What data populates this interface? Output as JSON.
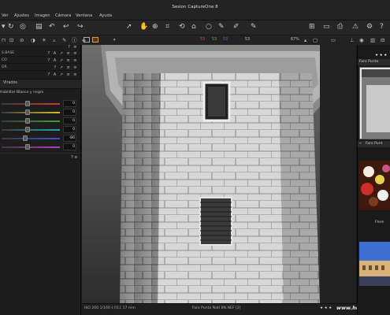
{
  "window": {
    "title": "Sesion CaptureOne 8"
  },
  "menu": [
    "Ver",
    "Ajustes",
    "Imagen",
    "Cámara",
    "Ventana",
    "Ayuda"
  ],
  "toolbar": {
    "zoom": "67%",
    "proof_values": [
      "53",
      "53",
      "53",
      "53"
    ]
  },
  "left_panel": {
    "tool_rows": [
      "S BASE",
      "CO",
      "OR"
    ],
    "bw_tab": "Virados",
    "bw_checkbox": "Habilitar Blanco y negro",
    "sliders": [
      {
        "color": "#d33",
        "position": 0.44,
        "value": "0"
      },
      {
        "color": "#d8c020",
        "position": 0.44,
        "value": "0"
      },
      {
        "color": "#3aa13a",
        "position": 0.44,
        "value": "0"
      },
      {
        "color": "#22a7b3",
        "position": 0.44,
        "value": "0"
      },
      {
        "color": "#3a4fd0",
        "position": 0.4,
        "value": "-86"
      },
      {
        "color": "#c03ac0",
        "position": 0.44,
        "value": "0"
      }
    ]
  },
  "status_bar": {
    "exif": "ISO 200  1/160 s  f/11  17 mm",
    "filename": "Faro Punta Nati BN.NEF [2]",
    "rating": "★ ★ ★",
    "watermark": "www.hugorodriguez.com"
  },
  "right_panel": {
    "rating_top": "★ ★ ★",
    "selected_name": "Faro Punta",
    "thumb2_name": "Faro Punt",
    "thumb3_name": "Flore"
  }
}
